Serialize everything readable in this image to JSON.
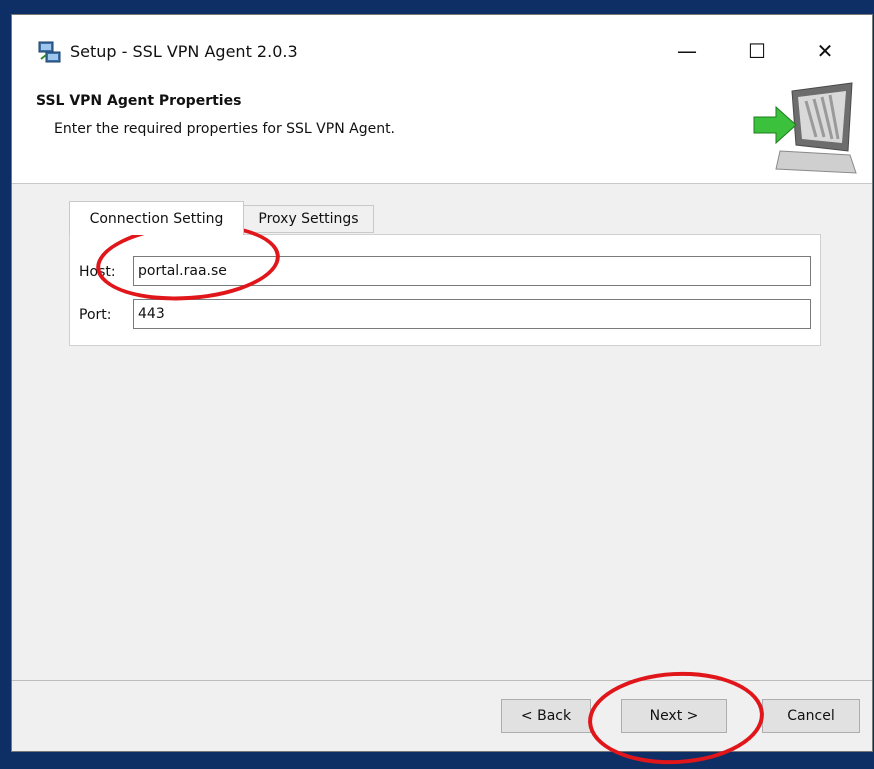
{
  "window": {
    "title": "Setup - SSL VPN Agent 2.0.3",
    "controls": {
      "minimize": "—",
      "maximize": "☐",
      "close": "✕"
    }
  },
  "header": {
    "title": "SSL VPN Agent Properties",
    "subtitle": "Enter the required properties for SSL VPN Agent."
  },
  "tabs": [
    {
      "label": "Connection Setting",
      "active": true
    },
    {
      "label": "Proxy Settings",
      "active": false
    }
  ],
  "fields": {
    "host": {
      "label": "Host:",
      "value": "portal.raa.se"
    },
    "port": {
      "label": "Port:",
      "value": "443"
    }
  },
  "buttons": {
    "back": "< Back",
    "next": "Next >",
    "cancel": "Cancel"
  },
  "colors": {
    "annotation": "#e0161b",
    "desktop": "#0d2f66"
  }
}
